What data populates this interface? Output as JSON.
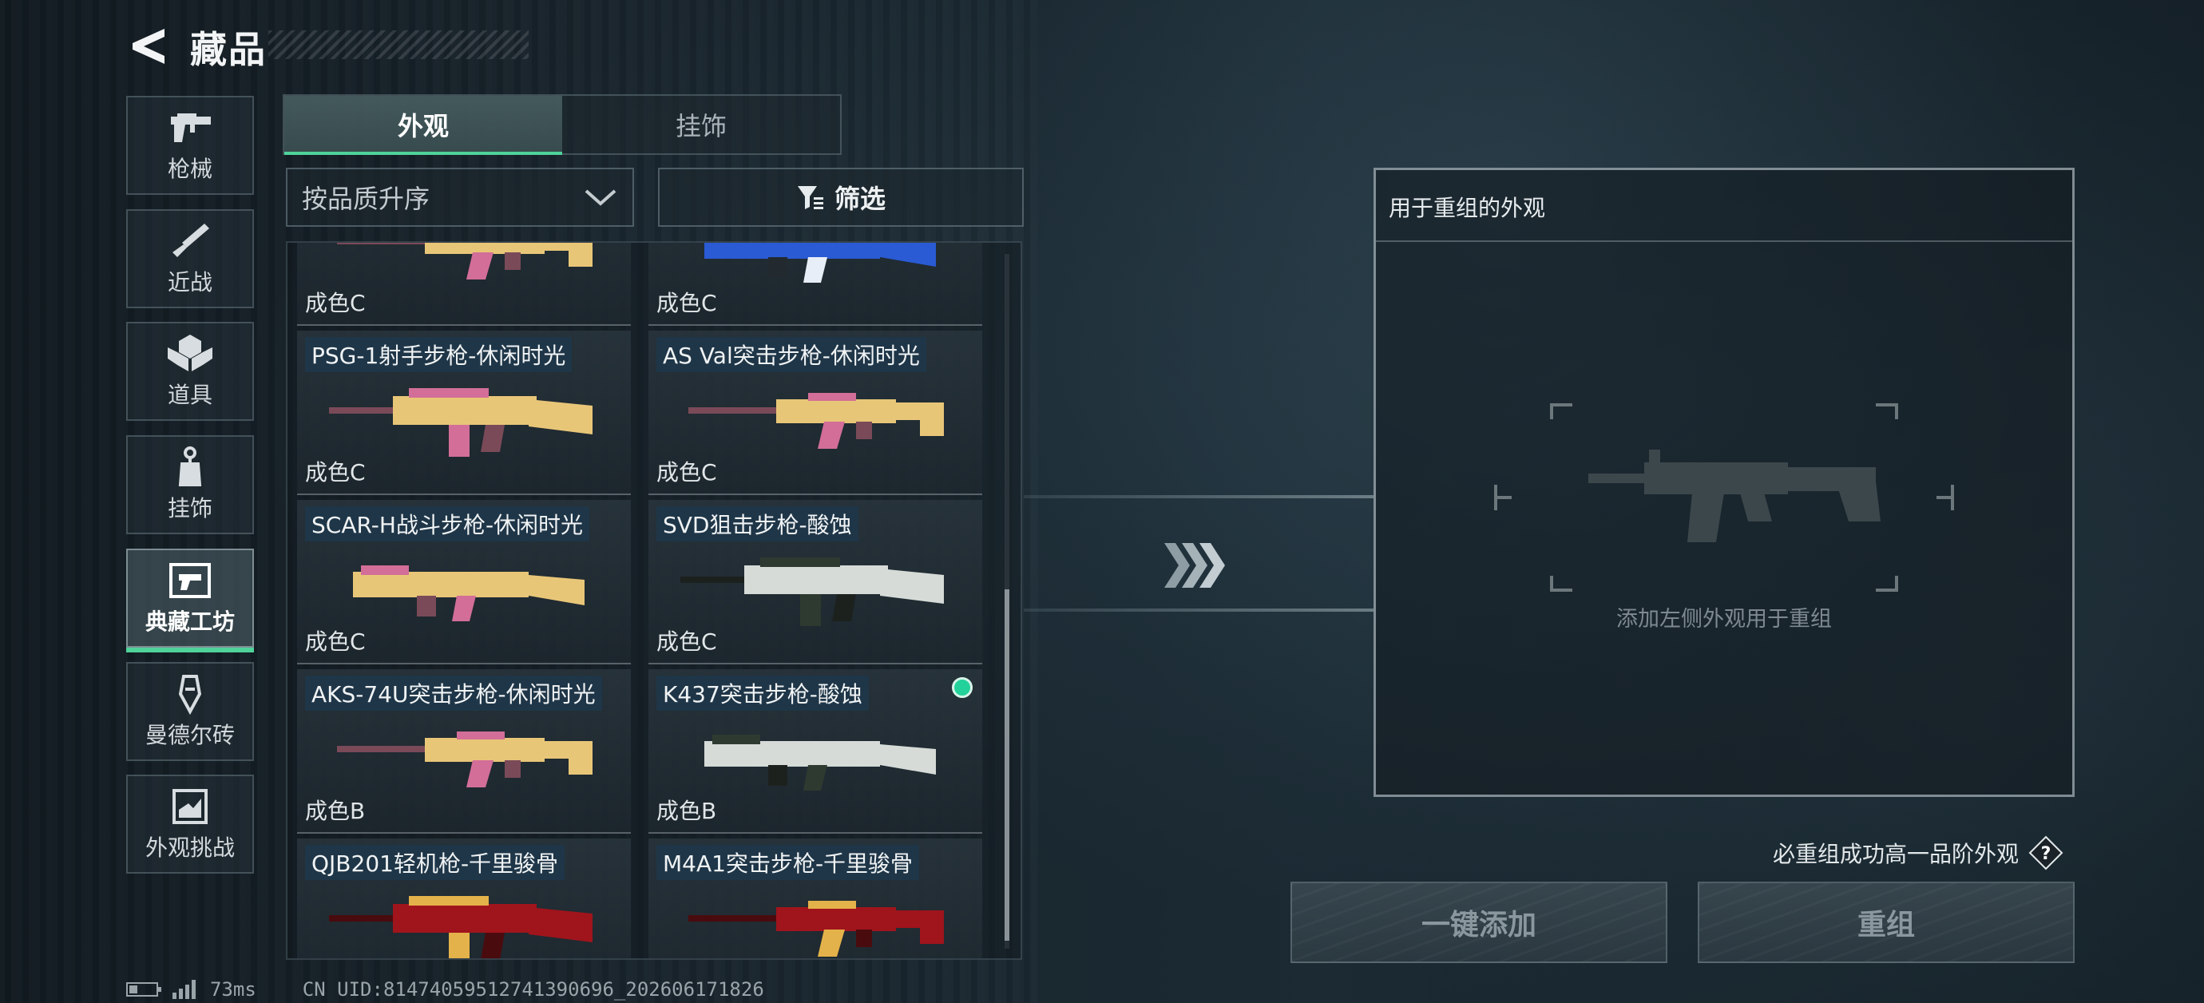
{
  "header": {
    "title": "藏品"
  },
  "nav": {
    "items": [
      {
        "label": "枪械",
        "icon": "gun-icon",
        "active": false
      },
      {
        "label": "近战",
        "icon": "knife-icon",
        "active": false
      },
      {
        "label": "道具",
        "icon": "grenade-icon",
        "active": false
      },
      {
        "label": "挂饰",
        "icon": "charm-icon",
        "active": false
      },
      {
        "label": "典藏工坊",
        "icon": "workshop-icon",
        "active": true
      },
      {
        "label": "曼德尔砖",
        "icon": "brick-icon",
        "active": false
      },
      {
        "label": "外观挑战",
        "icon": "challenge-icon",
        "active": false
      }
    ]
  },
  "tabs": [
    {
      "label": "外观",
      "active": true
    },
    {
      "label": "挂饰",
      "active": false
    }
  ],
  "sort": {
    "selected": "按品质升序"
  },
  "filter": {
    "label": "筛选"
  },
  "grid": {
    "items": [
      {
        "name": "",
        "grade": "成色C",
        "finish": "yellow",
        "selected": false
      },
      {
        "name": "",
        "grade": "成色C",
        "finish": "blue",
        "selected": false
      },
      {
        "name": "PSG-1射手步枪-休闲时光",
        "grade": "成色C",
        "finish": "yellow",
        "selected": false
      },
      {
        "name": "AS Val突击步枪-休闲时光",
        "grade": "成色C",
        "finish": "yellow",
        "selected": false
      },
      {
        "name": "SCAR-H战斗步枪-休闲时光",
        "grade": "成色C",
        "finish": "yellow",
        "selected": false
      },
      {
        "name": "SVD狙击步枪-酸蚀",
        "grade": "成色C",
        "finish": "acid",
        "selected": false
      },
      {
        "name": "AKS-74U突击步枪-休闲时光",
        "grade": "成色B",
        "finish": "yellow",
        "selected": false
      },
      {
        "name": "K437突击步枪-酸蚀",
        "grade": "成色B",
        "finish": "acid",
        "selected": true
      },
      {
        "name": "QJB201轻机枪-千里骏骨",
        "grade": "",
        "finish": "red",
        "selected": false
      },
      {
        "name": "M4A1突击步枪-千里骏骨",
        "grade": "",
        "finish": "red",
        "selected": false
      }
    ]
  },
  "recombine": {
    "title": "用于重组的外观",
    "placeholder": "添加左侧外观用于重组",
    "guarantee": "必重组成功高一品阶外观",
    "help_symbol": "?",
    "add_button": "一键添加",
    "recombine_button": "重组"
  },
  "status": {
    "ping": "73ms",
    "uid": "CN UID:81474059512741390696_202606171826"
  },
  "colors": {
    "accent": "#4fd39a",
    "selected_dot": "#23d19a",
    "name_tag_bg": "#1e374b"
  }
}
